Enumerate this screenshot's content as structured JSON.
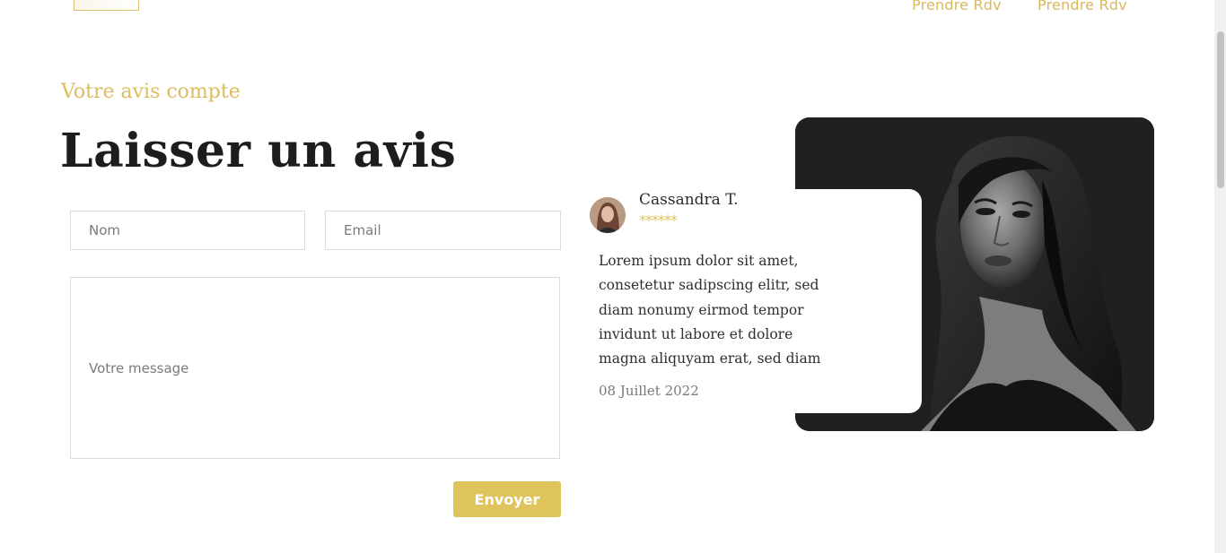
{
  "nav": {
    "links": [
      "Prendre Rdv",
      "Prendre Rdv"
    ]
  },
  "section": {
    "eyebrow": "Votre avis compte",
    "title": "Laisser un avis"
  },
  "form": {
    "name_placeholder": "Nom",
    "email_placeholder": "Email",
    "message_placeholder": "Votre message",
    "submit_label": "Envoyer"
  },
  "review": {
    "author": "Cassandra T.",
    "stars": "******",
    "text": "Lorem ipsum dolor sit amet, consetetur sadipscing elitr, sed diam nonumy eirmod tempor invidunt ut labore et dolore magna aliquyam erat, sed diam",
    "date": "08 Juillet 2022"
  },
  "colors": {
    "accent": "#dfc35d",
    "text_dark": "#1d1d1d",
    "photo_bg": "#1f2022"
  }
}
